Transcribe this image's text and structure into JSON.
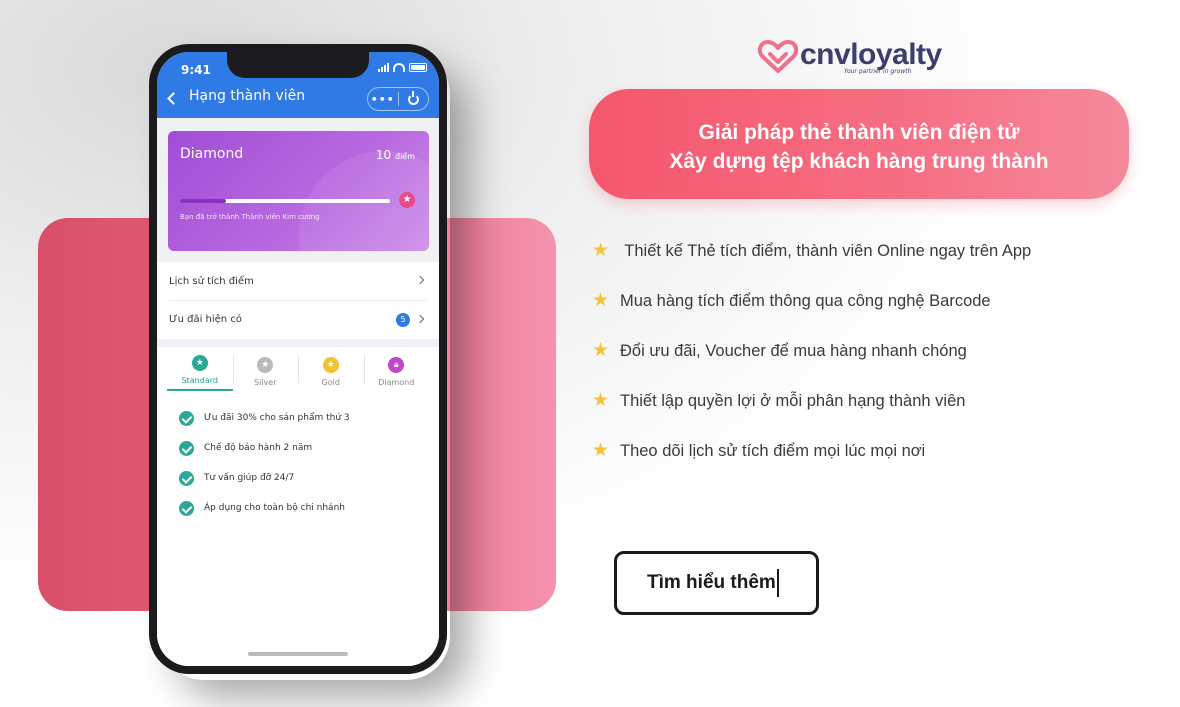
{
  "phone": {
    "status": {
      "time": "9:41"
    },
    "nav": {
      "title": "Hạng thành viên",
      "more": "•••"
    },
    "card": {
      "tier": "Diamond",
      "points": "10",
      "points_unit": "điểm",
      "progress": 0.22,
      "note": "Bạn đã trở thành Thành viên Kim cương",
      "star_icon": "star-icon"
    },
    "menu": [
      {
        "label": "Lịch sử tích điểm"
      },
      {
        "label": "Ưu đãi hiện có",
        "badge": "5"
      }
    ],
    "tiers": [
      {
        "label": "Standard",
        "color": "#2aa895",
        "active": true
      },
      {
        "label": "Silver",
        "color": "#b9b9b9"
      },
      {
        "label": "Gold",
        "color": "#f1c232"
      },
      {
        "label": "Diamond",
        "color": "#c246c9"
      }
    ],
    "benefits": [
      "Ưu đãi 30% cho sản phẩm thứ 3",
      "Chế độ bảo hành 2 năm",
      "Tư vấn giúp đỡ 24/7",
      "Áp dụng cho toàn bộ chi nhánh"
    ]
  },
  "brand": {
    "name": "cnvloyalty",
    "tagline": "Your partner in growth",
    "accent": "#f5576c",
    "text_color": "#3b3f6e"
  },
  "headline": {
    "line1": "Giải pháp thẻ thành viên điện tử",
    "line2": "Xây dựng tệp khách hàng trung thành"
  },
  "features": [
    " Thiết kế Thẻ tích điểm, thành viên Online ngay trên App",
    "Mua hàng tích điểm thông qua công nghệ Barcode",
    "Đổi ưu đãi, Voucher để mua hàng nhanh chóng",
    "Thiết lập quyền lợi ở mỗi phân hạng thành viên",
    "Theo dõi lịch sử tích điểm mọi lúc mọi nơi"
  ],
  "cta": {
    "label": "Tìm hiểu thêm"
  }
}
